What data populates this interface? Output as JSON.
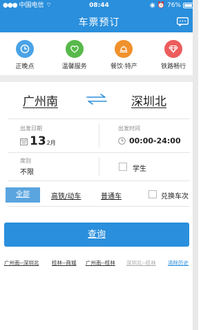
{
  "status_bar": {
    "carrier": "中国电信",
    "time": "08:44",
    "battery": "76%",
    "battery_level": 0.76
  },
  "header": {
    "title": "车票预订",
    "message_icon": "message-icon"
  },
  "categories": [
    {
      "label": "正晚点",
      "icon": "clock-icon",
      "color": "#4aa3e6"
    },
    {
      "label": "温馨服务",
      "icon": "heart-icon",
      "color": "#57b94a"
    },
    {
      "label": "餐饮·特产",
      "icon": "food-icon",
      "color": "#f0912c"
    },
    {
      "label": "铁路畅行",
      "icon": "gem-icon",
      "color": "#ec5d5d"
    }
  ],
  "route": {
    "from": "广州南",
    "to": "深圳北"
  },
  "date": {
    "label": "出发日期",
    "day": "13",
    "month": "2月"
  },
  "time": {
    "label": "出发时间",
    "value": "00:00-24:00"
  },
  "seat": {
    "label": "席别",
    "value": "不限"
  },
  "student": {
    "label": "学生"
  },
  "train_types": {
    "all": "全部",
    "high_speed": "高铁/动车",
    "normal": "普通车",
    "transfer": "兑换车次"
  },
  "query_button": "查询",
  "history": {
    "items": [
      "广州南--深圳北",
      "桂林--商城",
      "广州南--桂林",
      "深圳北--桂林"
    ],
    "clear": "清除历史"
  },
  "colors": {
    "brand": "#2a8fdc",
    "active_tab": "#5aa5e0"
  }
}
